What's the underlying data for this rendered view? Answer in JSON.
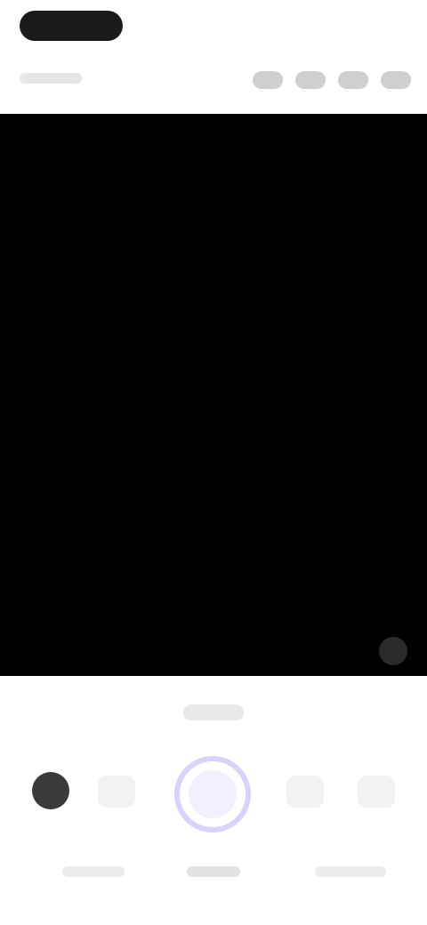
{
  "status_bar": {
    "time": ""
  },
  "top_bar": {
    "left_label": "",
    "icons": [
      "flash-icon",
      "timer-icon",
      "settings-icon",
      "more-icon"
    ]
  },
  "viewfinder": {
    "state": "camera-preview",
    "corner_icon": "zoom-icon"
  },
  "mode_strip": {
    "selected_mode_label": ""
  },
  "controls": {
    "left_avatar_icon": "gallery-thumb-icon",
    "left_ctrl_icon": "ctrl-icon",
    "shutter_icon": "shutter-icon",
    "right_ctrl_icon": "ctrl-icon",
    "right_ctrl2_icon": "ctrl-icon"
  },
  "bottom_nav": {
    "left_label": "",
    "center_label": "",
    "right_label": ""
  }
}
